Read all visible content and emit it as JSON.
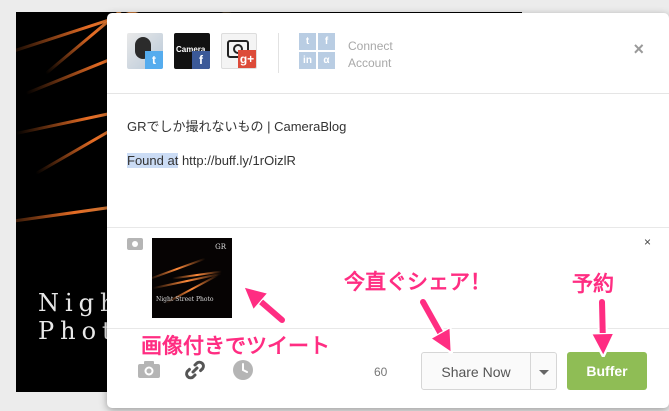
{
  "background_photo": {
    "caption_line1": "Nigh",
    "caption_line2": "Photo"
  },
  "profiles": [
    {
      "name": "twitter-profile",
      "network_glyph": "t",
      "color": "#55acee"
    },
    {
      "name": "facebook-profile",
      "network_glyph": "f",
      "color": "#3b5998"
    },
    {
      "name": "googleplus-profile",
      "network_glyph": "g+",
      "color": "#dd4b39"
    }
  ],
  "connect": {
    "line1": "Connect",
    "line2": "Account",
    "tiles": [
      "t",
      "f",
      "in",
      "α"
    ]
  },
  "close_glyph": "×",
  "composer": {
    "title": "GRでしか撮れないもの | CameraBlog",
    "found_at": "Found at",
    "url": "http://buff.ly/1rOizlR"
  },
  "attachment": {
    "thumb_brand": "GR",
    "thumb_caption": "Night Street Photo",
    "remove_glyph": "×"
  },
  "footer": {
    "char_count": "60",
    "share_now_label": "Share Now",
    "buffer_label": "Buffer",
    "icons": [
      "camera-icon",
      "link-icon",
      "clock-icon"
    ]
  },
  "annotations": {
    "image_tweet": "画像付きでツイート",
    "share_now": "今直ぐシェア！",
    "schedule": "予約"
  },
  "colors": {
    "annotation": "#ff2d82",
    "buffer_green": "#8fbd55",
    "highlight": "#cbdcf5"
  }
}
